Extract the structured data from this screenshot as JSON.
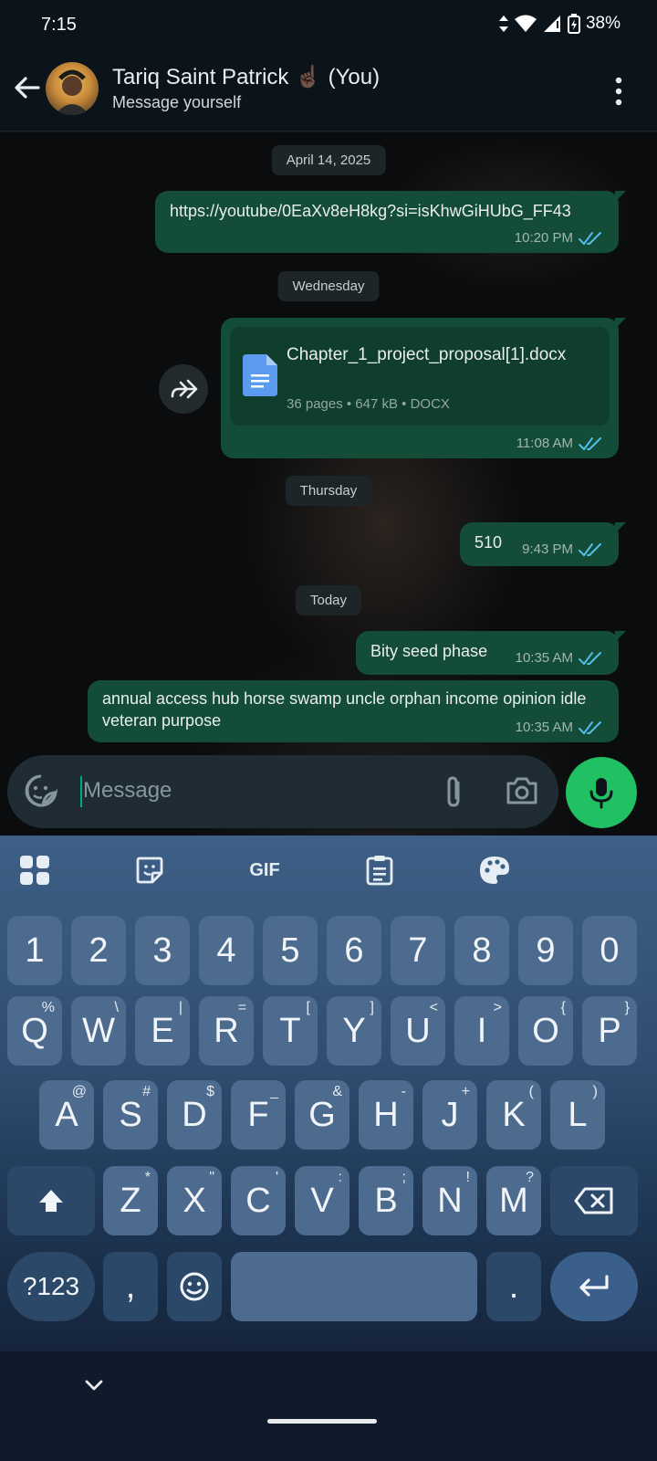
{
  "status_bar": {
    "time": "7:15",
    "battery": "38%"
  },
  "header": {
    "contact_name": "Tariq Saint Patrick ☝🏿 (You)",
    "subtitle": "Message yourself"
  },
  "messages": {
    "date1": "April 14, 2025",
    "link_text": "https://youtube/0EaXv8eH8kg?si=isKhwGiHUbG_FF43",
    "link_time": "10:20 PM",
    "date2": "Wednesday",
    "doc_name": "Chapter_1_project_proposal[1].docx",
    "doc_info": "36 pages • 647 kB • DOCX",
    "doc_time": "11:08 AM",
    "date3": "Thursday",
    "msg510_text": "510",
    "msg510_time": "9:43 PM",
    "date4": "Today",
    "bity_text": "Bity seed phase",
    "bity_time": "10:35 AM",
    "seed_text": "annual access hub horse swamp uncle orphan income opinion idle veteran purpose",
    "seed_time": "10:35 AM"
  },
  "composer": {
    "placeholder": "Message"
  },
  "keyboard": {
    "gif_label": "GIF",
    "numbers": [
      "1",
      "2",
      "3",
      "4",
      "5",
      "6",
      "7",
      "8",
      "9",
      "0"
    ],
    "row_q": [
      {
        "key": "Q",
        "sup": "%"
      },
      {
        "key": "W",
        "sup": "\\"
      },
      {
        "key": "E",
        "sup": "|"
      },
      {
        "key": "R",
        "sup": "="
      },
      {
        "key": "T",
        "sup": "["
      },
      {
        "key": "Y",
        "sup": "]"
      },
      {
        "key": "U",
        "sup": "<"
      },
      {
        "key": "I",
        "sup": ">"
      },
      {
        "key": "O",
        "sup": "{"
      },
      {
        "key": "P",
        "sup": "}"
      }
    ],
    "row_a": [
      {
        "key": "A",
        "sup": "@"
      },
      {
        "key": "S",
        "sup": "#"
      },
      {
        "key": "D",
        "sup": "$"
      },
      {
        "key": "F",
        "sup": "_"
      },
      {
        "key": "G",
        "sup": "&"
      },
      {
        "key": "H",
        "sup": "-"
      },
      {
        "key": "J",
        "sup": "+"
      },
      {
        "key": "K",
        "sup": "("
      },
      {
        "key": "L",
        "sup": ")"
      }
    ],
    "row_z": [
      {
        "key": "Z",
        "sup": "*"
      },
      {
        "key": "X",
        "sup": "\""
      },
      {
        "key": "C",
        "sup": "'"
      },
      {
        "key": "V",
        "sup": ":"
      },
      {
        "key": "B",
        "sup": ";"
      },
      {
        "key": "N",
        "sup": "!"
      },
      {
        "key": "M",
        "sup": "?"
      }
    ],
    "symbols_label": "?123",
    "comma": ",",
    "period": "."
  },
  "colors": {
    "bubble": "#144d37",
    "tick_blue": "#53bdeb",
    "mic_green": "#21c063"
  }
}
